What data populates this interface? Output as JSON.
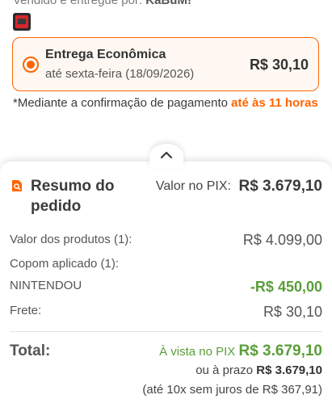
{
  "seller": {
    "prefix": "Vendido e entregue por: ",
    "name": "KaBuM!"
  },
  "product_thumb": {
    "icon": "nintendo-switch-thumb"
  },
  "shipping": {
    "name": "Entrega Econômica",
    "date": "até sexta-feira (18/09/2026)",
    "price": "R$ 30,10",
    "selected": true
  },
  "note": {
    "text": "*Mediante a confirmação de pagamento ",
    "highlight": "até às 11 horas"
  },
  "summary": {
    "collapse_icon": "chevron-up-icon",
    "title": "Resumo do pedido",
    "pix_label": "Valor no PIX:",
    "pix_value": "R$ 3.679,10",
    "rows": [
      {
        "label": "Valor dos produtos (1):",
        "value": "R$ 4.099,00"
      },
      {
        "label": "Copom aplicado (1):",
        "value": ""
      },
      {
        "label": "NINTENDOU",
        "value": "-R$ 450,00"
      },
      {
        "label": "Frete:",
        "value": "R$ 30,10"
      }
    ],
    "total_label": "Total:",
    "total_pix_prefix": "À vista no PIX ",
    "total_pix_value": "R$ 3.679,10",
    "total_prazo_prefix": "ou à prazo ",
    "total_prazo_value": "R$ 3.679,10",
    "installments": "(até 10x sem juros de R$ 367,91)"
  },
  "colors": {
    "accent": "#ff6500",
    "discount": "#5a9e3a",
    "text": "#3b3b3b"
  }
}
